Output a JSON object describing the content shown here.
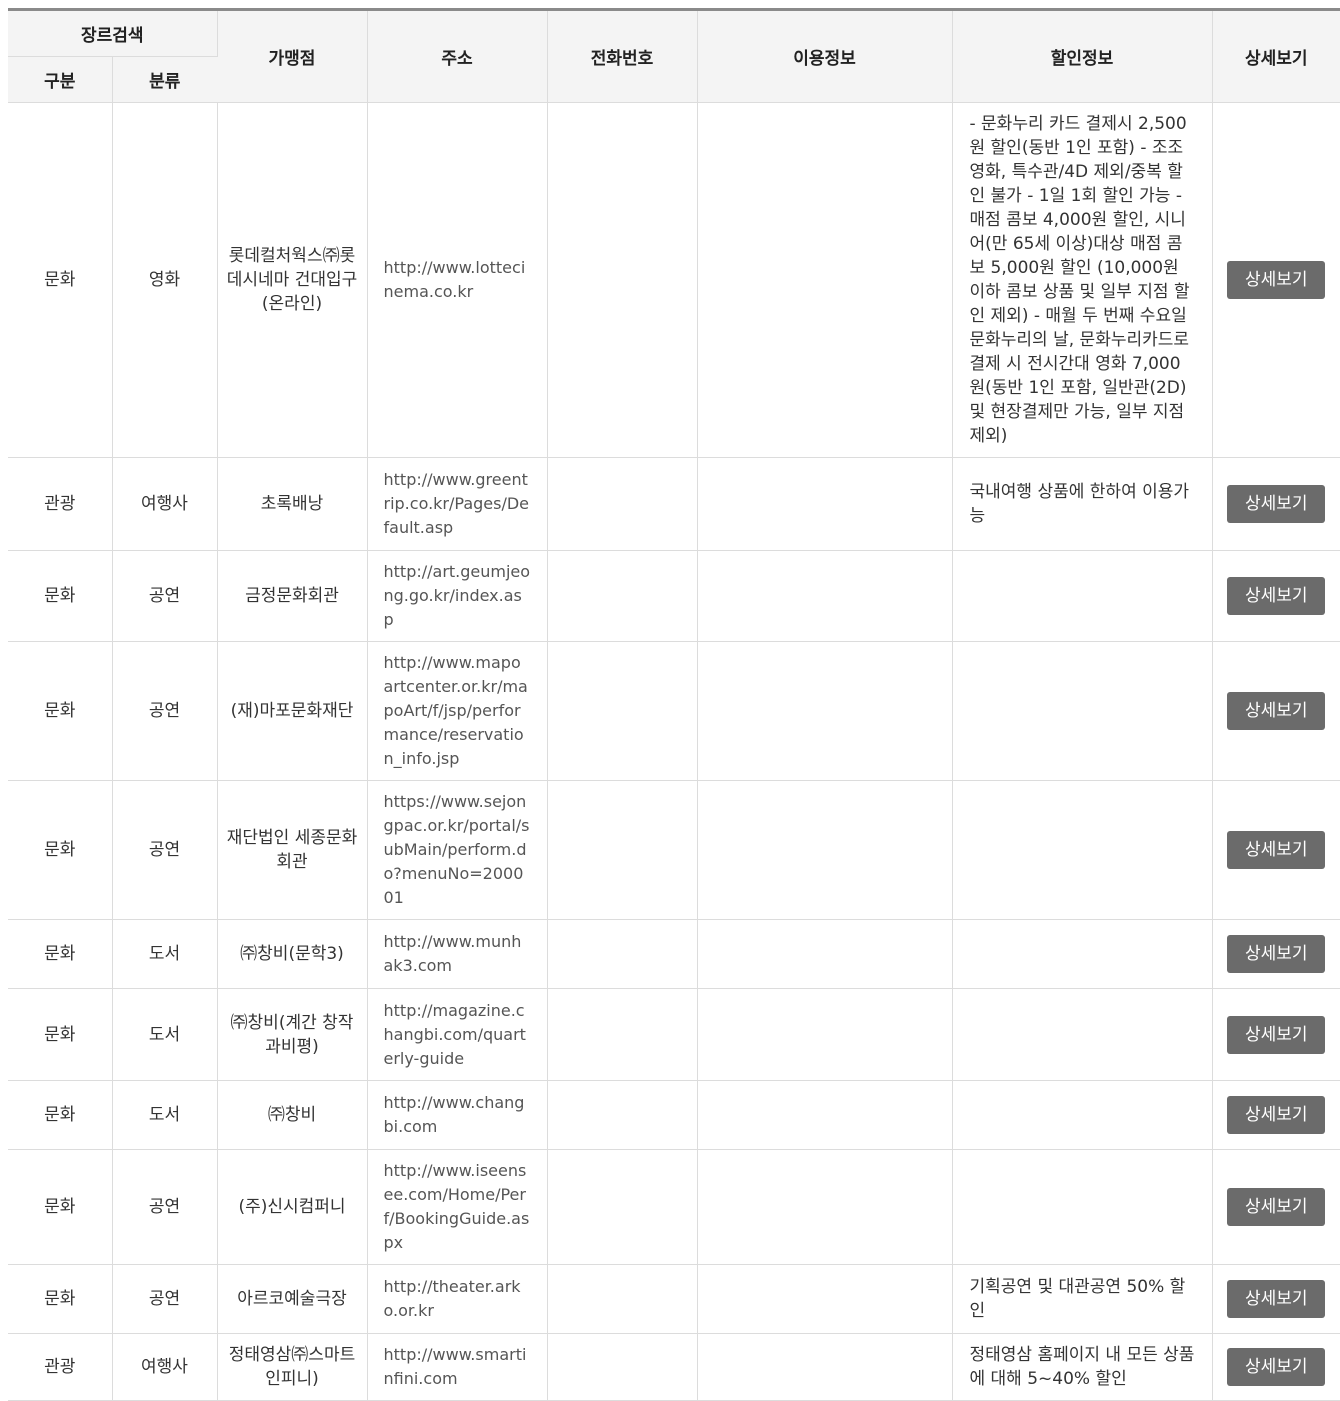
{
  "header": {
    "genre_search": "장르검색",
    "category": "구분",
    "classification": "분류",
    "store": "가맹점",
    "address": "주소",
    "phone": "전화번호",
    "usage_info": "이용정보",
    "discount_info": "할인정보",
    "detail": "상세보기"
  },
  "detail_button_label": "상세보기",
  "rows": [
    {
      "category": "문화",
      "classification": "영화",
      "store": "롯데컬처웍스㈜롯데시네마 건대입구(온라인)",
      "url": "http://www.lottecinema.co.kr",
      "phone": "",
      "usage": "",
      "discount": "- 문화누리 카드 결제시 2,500원 할인(동반 1인 포함) - 조조영화, 특수관/4D 제외/중복 할인 불가 - 1일 1회 할인 가능 - 매점 콤보 4,000원 할인, 시니어(만 65세 이상)대상 매점 콤보 5,000원 할인 (10,000원 이하 콤보 상품 및 일부 지점 할인 제외) - 매월 두 번째 수요일 문화누리의 날, 문화누리카드로 결제 시 전시간대 영화 7,000원(동반 1인 포함, 일반관(2D) 및 현장결제만 가능, 일부 지점 제외)"
    },
    {
      "category": "관광",
      "classification": "여행사",
      "store": "초록배낭",
      "url": "http://www.greentrip.co.kr/Pages/Default.asp",
      "phone": "",
      "usage": "",
      "discount": "국내여행 상품에 한하여 이용가능"
    },
    {
      "category": "문화",
      "classification": "공연",
      "store": "금정문화회관",
      "url": "http://art.geumjeong.go.kr/index.asp",
      "phone": "",
      "usage": "",
      "discount": ""
    },
    {
      "category": "문화",
      "classification": "공연",
      "store": "(재)마포문화재단",
      "url": "http://www.mapoartcenter.or.kr/mapoArt/f/jsp/performance/reservation_info.jsp",
      "phone": "",
      "usage": "",
      "discount": ""
    },
    {
      "category": "문화",
      "classification": "공연",
      "store": "재단법인 세종문화회관",
      "url": "https://www.sejongpac.or.kr/portal/subMain/perform.do?menuNo=200001",
      "phone": "",
      "usage": "",
      "discount": ""
    },
    {
      "category": "문화",
      "classification": "도서",
      "store": "㈜창비(문학3)",
      "url": "http://www.munhak3.com",
      "phone": "",
      "usage": "",
      "discount": ""
    },
    {
      "category": "문화",
      "classification": "도서",
      "store": "㈜창비(계간 창작과비평)",
      "url": "http://magazine.changbi.com/quarterly-guide",
      "phone": "",
      "usage": "",
      "discount": ""
    },
    {
      "category": "문화",
      "classification": "도서",
      "store": "㈜창비",
      "url": "http://www.changbi.com",
      "phone": "",
      "usage": "",
      "discount": ""
    },
    {
      "category": "문화",
      "classification": "공연",
      "store": "(주)신시컴퍼니",
      "url": "http://www.iseensee.com/Home/Perf/BookingGuide.aspx",
      "phone": "",
      "usage": "",
      "discount": ""
    },
    {
      "category": "문화",
      "classification": "공연",
      "store": "아르코예술극장",
      "url": "http://theater.arko.or.kr",
      "phone": "",
      "usage": "",
      "discount": "기획공연 및 대관공연 50% 할인"
    },
    {
      "category": "관광",
      "classification": "여행사",
      "store": "정태영삼㈜스마트인피니)",
      "url": "http://www.smartinfini.com",
      "phone": "",
      "usage": "",
      "discount": "정태영삼 홈페이지 내 모든 상품에 대해 5~40% 할인"
    }
  ]
}
